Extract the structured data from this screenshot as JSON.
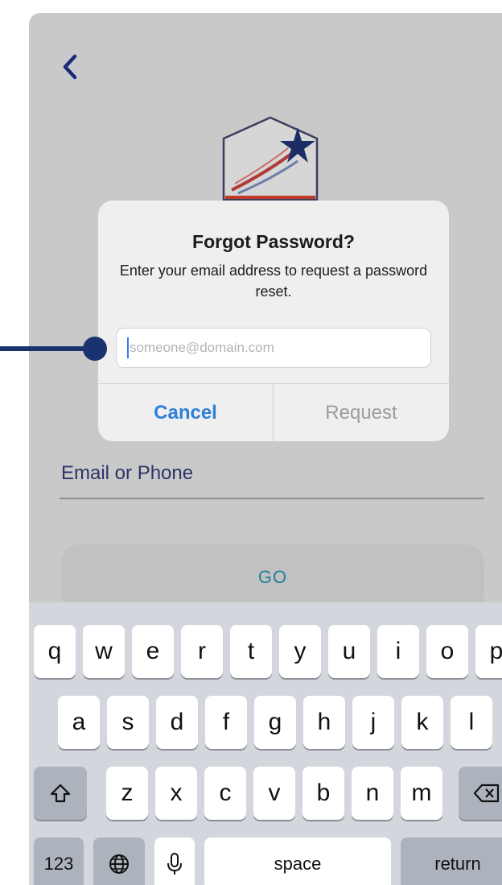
{
  "screen": {
    "back_icon": "chevron-left-icon",
    "logo_icon": "shield-star-logo",
    "email_label": "Email or Phone",
    "go_label": "GO"
  },
  "dialog": {
    "title": "Forgot Password?",
    "message": "Enter your email address to request a password reset.",
    "input_placeholder": "someone@domain.com",
    "input_value": "",
    "cancel_label": "Cancel",
    "request_label": "Request"
  },
  "keyboard": {
    "row1": [
      "q",
      "w",
      "e",
      "r",
      "t",
      "y",
      "u",
      "i",
      "o",
      "p"
    ],
    "row2": [
      "a",
      "s",
      "d",
      "f",
      "g",
      "h",
      "j",
      "k",
      "l"
    ],
    "row3": [
      "z",
      "x",
      "c",
      "v",
      "b",
      "n",
      "m"
    ],
    "numbers_label": "123",
    "space_label": "space",
    "return_label": "return",
    "shift_icon": "shift-icon",
    "backspace_icon": "backspace-icon",
    "globe_icon": "globe-icon",
    "mic_icon": "microphone-icon"
  },
  "colors": {
    "accent": "#2f7fd6",
    "brand_navy": "#1a3270",
    "overlay": "#c9c9c9",
    "go_text": "#1f7f9a"
  }
}
